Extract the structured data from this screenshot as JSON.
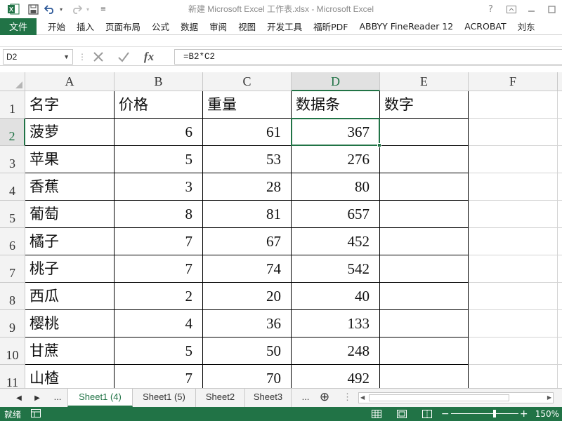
{
  "titlebar": {
    "title": "新建 Microsoft Excel 工作表.xlsx - Microsoft Excel",
    "help": "?",
    "icons": [
      "excel-logo",
      "save-icon",
      "undo-icon",
      "redo-icon",
      "customize-qat-icon",
      "restore-ribbon-icon",
      "minimize-icon",
      "maximize-icon"
    ]
  },
  "ribbon": {
    "file_label": "文件",
    "tabs": [
      "开始",
      "插入",
      "页面布局",
      "公式",
      "数据",
      "审阅",
      "视图",
      "开发工具",
      "福昕PDF",
      "ABBYY FineReader 12",
      "ACROBAT",
      "刘东"
    ],
    "accent": "#217346"
  },
  "formula_bar": {
    "name_box": "D2",
    "cancel": "✕",
    "enter": "✓",
    "fx": "fx",
    "formula": "=B2*C2"
  },
  "grid": {
    "columns": [
      "A",
      "B",
      "C",
      "D",
      "E",
      "F"
    ],
    "rows": [
      "1",
      "2",
      "3",
      "4",
      "5",
      "6",
      "7",
      "8",
      "9",
      "10",
      "11"
    ],
    "active_cell": "D2",
    "header": [
      "名字",
      "价格",
      "重量",
      "数据条",
      "数字"
    ],
    "data": [
      [
        "菠萝",
        "6",
        "61",
        "367",
        ""
      ],
      [
        "苹果",
        "5",
        "53",
        "276",
        ""
      ],
      [
        "香蕉",
        "3",
        "28",
        "80",
        ""
      ],
      [
        "葡萄",
        "8",
        "81",
        "657",
        ""
      ],
      [
        "橘子",
        "7",
        "67",
        "452",
        ""
      ],
      [
        "桃子",
        "7",
        "74",
        "542",
        ""
      ],
      [
        "西瓜",
        "2",
        "20",
        "40",
        ""
      ],
      [
        "樱桃",
        "4",
        "36",
        "133",
        ""
      ],
      [
        "甘蔗",
        "5",
        "50",
        "248",
        ""
      ],
      [
        "山楂",
        "7",
        "70",
        "492",
        ""
      ]
    ]
  },
  "sheets": {
    "more_left": "...",
    "tabs": [
      "Sheet1 (4)",
      "Sheet1 (5)",
      "Sheet2",
      "Sheet3"
    ],
    "active": "Sheet1 (4)",
    "more_right": "...",
    "add": "⊕"
  },
  "status": {
    "ready": "就绪",
    "zoom": "150%"
  }
}
